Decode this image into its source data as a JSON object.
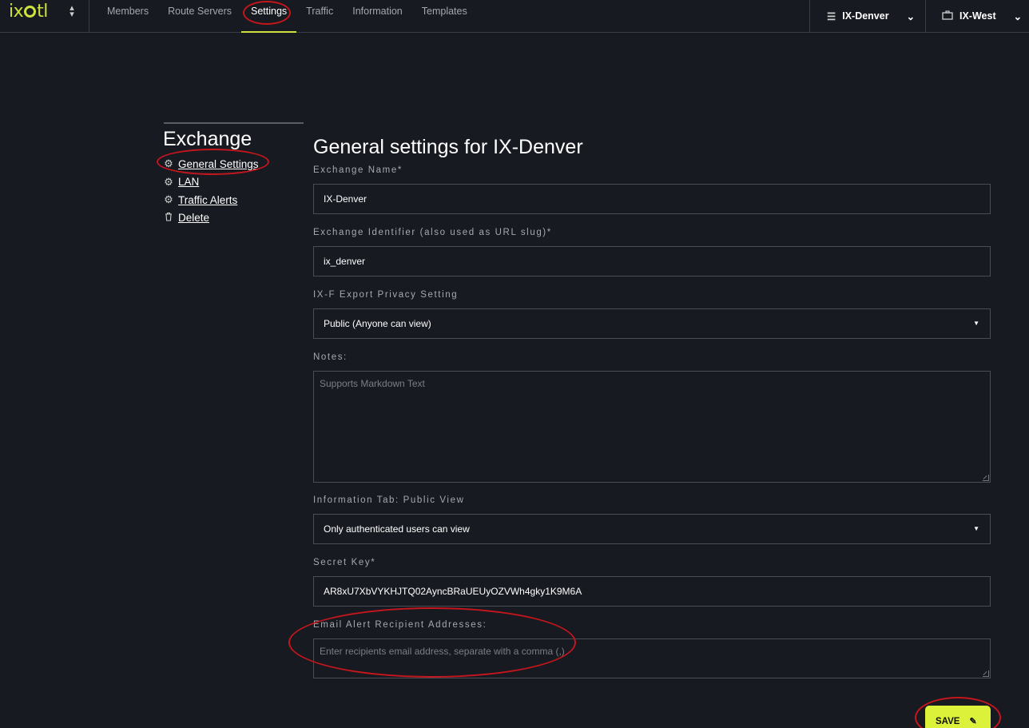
{
  "app": {
    "logo_text": "ix",
    "logo_text_end": "tl"
  },
  "nav": {
    "items": [
      {
        "label": "Members"
      },
      {
        "label": "Route Servers"
      },
      {
        "label": "Settings"
      },
      {
        "label": "Traffic"
      },
      {
        "label": "Information"
      },
      {
        "label": "Templates"
      }
    ],
    "active": "Settings",
    "exchange_selector": "IX-Denver",
    "org_selector": "IX-West"
  },
  "sidebar": {
    "title": "Exchange",
    "items": [
      {
        "label": "General Settings",
        "icon": "gear-icon"
      },
      {
        "label": "LAN",
        "icon": "gear-icon"
      },
      {
        "label": "Traffic Alerts",
        "icon": "gear-icon"
      },
      {
        "label": "Delete",
        "icon": "trash-icon"
      }
    ]
  },
  "form": {
    "title": "General settings for IX-Denver",
    "exchange_name": {
      "label": "Exchange Name*",
      "value": "IX-Denver"
    },
    "exchange_identifier": {
      "label": "Exchange Identifier (also used as URL slug)*",
      "value": "ix_denver"
    },
    "ixf_privacy": {
      "label": "IX-F Export Privacy Setting",
      "value": "Public (Anyone can view)"
    },
    "notes": {
      "label": "Notes:",
      "placeholder": "Supports Markdown Text"
    },
    "info_tab": {
      "label": "Information Tab: Public View",
      "value": "Only authenticated users can view"
    },
    "secret_key": {
      "label": "Secret Key*",
      "value": "AR8xU7XbVYKHJTQ02AyncBRaUEUyOZVWh4gky1K9M6A"
    },
    "email_alert": {
      "label": "Email Alert Recipient Addresses:",
      "placeholder": "Enter recipients email address, separate with a comma (,)"
    },
    "save_label": "SAVE"
  },
  "colors": {
    "accent": "#dcf23a",
    "background": "#171a21",
    "annotation": "#c4161c"
  }
}
